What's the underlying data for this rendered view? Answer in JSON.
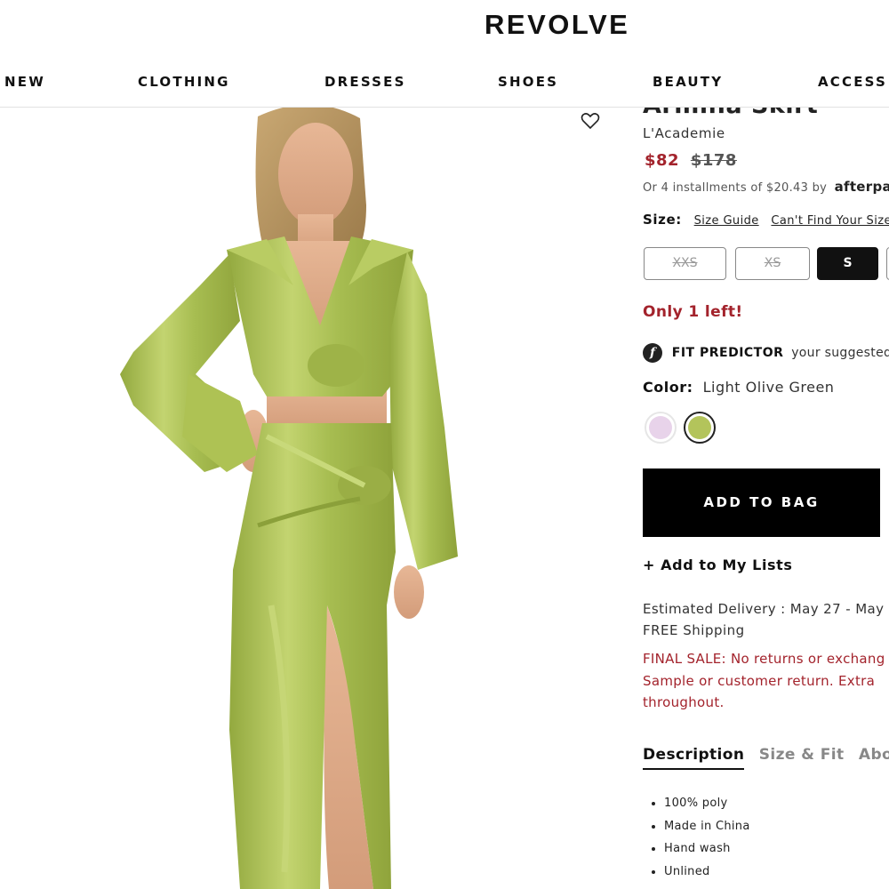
{
  "header": {
    "logo": "REVOLVE",
    "nav": [
      "NEW",
      "CLOTHING",
      "DRESSES",
      "SHOES",
      "BEAUTY",
      "ACCESS"
    ]
  },
  "product": {
    "name": "Armina Skirt",
    "brand": "L'Academie",
    "price_sale": "$82",
    "price_original": "$178",
    "installments_text": "Or 4 installments of $20.43 by",
    "afterpay_label": "afterpa",
    "size_label": "Size:",
    "size_guide": "Size Guide",
    "cant_find_size": "Can't Find Your Size",
    "sizes": [
      {
        "label": "XXS",
        "available": false
      },
      {
        "label": "XS",
        "available": false
      },
      {
        "label": "S",
        "available": true,
        "selected": true
      }
    ],
    "stock": "Only 1 left!",
    "fit_predictor_title": "FIT PREDICTOR",
    "fit_predictor_text": "your suggested",
    "color_label": "Color:",
    "color_value": "Light Olive Green",
    "swatches": [
      {
        "name": "lilac",
        "color": "#e8d3ea",
        "selected": false
      },
      {
        "name": "light-olive-green",
        "color": "#b3c45b",
        "selected": true
      }
    ],
    "add_to_bag": "ADD TO BAG",
    "add_to_lists": "+ Add to My Lists",
    "delivery": "Estimated Delivery : May 27 - May",
    "shipping": "FREE Shipping",
    "final_sale_lines": [
      "FINAL SALE: No returns or exchang",
      "Sample or customer return. Extra",
      "throughout."
    ],
    "tabs": [
      "Description",
      "Size & Fit",
      "About"
    ],
    "description_items": [
      "100% poly",
      "Made in China",
      "Hand wash",
      "Unlined"
    ]
  },
  "colors": {
    "sale_red": "#a3232c",
    "garment_green": "#a8bd54",
    "button_black": "#000000"
  }
}
